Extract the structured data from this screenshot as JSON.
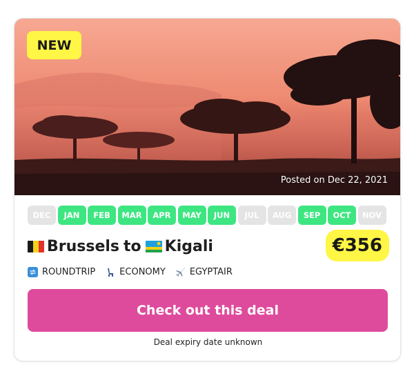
{
  "badge": "NEW",
  "posted": "Posted on Dec 22, 2021",
  "months": [
    {
      "label": "DEC",
      "active": false
    },
    {
      "label": "JAN",
      "active": true
    },
    {
      "label": "FEB",
      "active": true
    },
    {
      "label": "MAR",
      "active": true
    },
    {
      "label": "APR",
      "active": true
    },
    {
      "label": "MAY",
      "active": true
    },
    {
      "label": "JUN",
      "active": true
    },
    {
      "label": "JUL",
      "active": false
    },
    {
      "label": "AUG",
      "active": false
    },
    {
      "label": "SEP",
      "active": true
    },
    {
      "label": "OCT",
      "active": true
    },
    {
      "label": "NOV",
      "active": false
    }
  ],
  "route": {
    "origin": "Brussels",
    "connector": "to",
    "destination": "Kigali",
    "origin_flag": "belgium-flag-icon",
    "destination_flag": "rwanda-flag-icon"
  },
  "price": "€356",
  "meta": {
    "trip_type": "ROUNDTRIP",
    "cabin": "ECONOMY",
    "airline": "EGYPTAIR",
    "trip_icon": "repeat-arrows-icon",
    "cabin_icon": "seat-icon",
    "airline_icon": "airplane-icon"
  },
  "cta_label": "Check out this deal",
  "expiry": "Deal expiry date unknown",
  "colors": {
    "accent_pink": "#de4b9c",
    "highlight_yellow": "#fff645",
    "month_active": "#3ee682",
    "month_inactive": "#e4e4e4"
  }
}
